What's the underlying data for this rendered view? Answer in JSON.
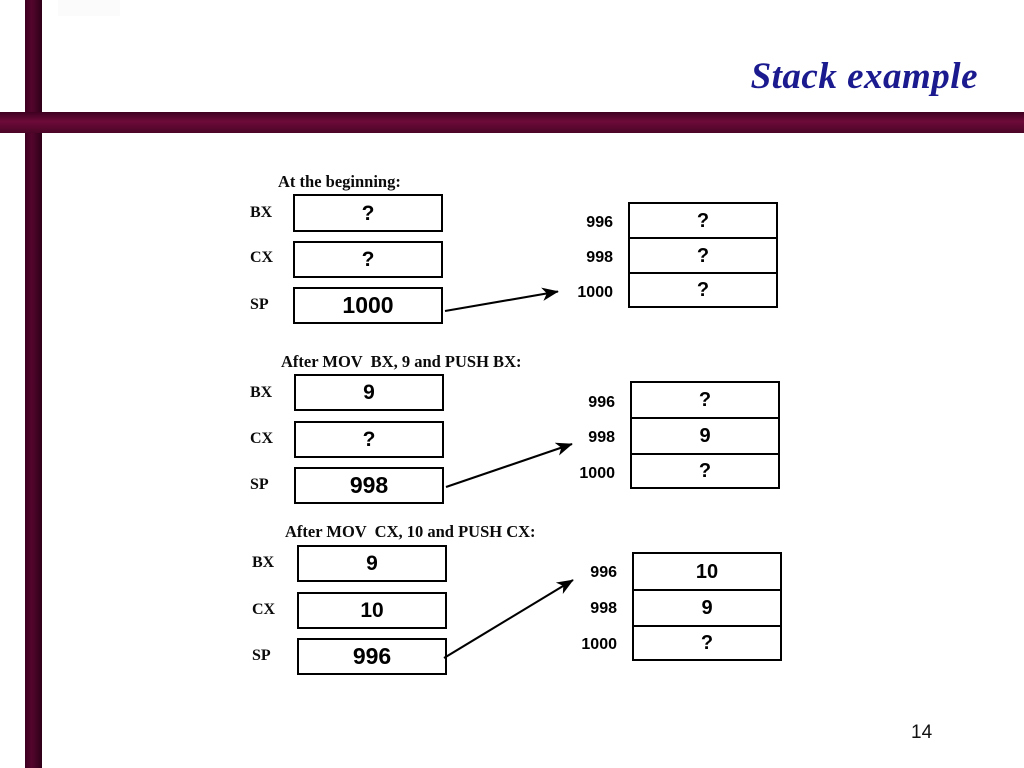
{
  "slide": {
    "title": "Stack example",
    "title_color": "#1b1b8f",
    "accent_color": "#54052c",
    "page_number": "14"
  },
  "blocks": [
    {
      "heading": "At the beginning:",
      "registers": [
        {
          "label": "BX",
          "value": "?"
        },
        {
          "label": "CX",
          "value": "?"
        },
        {
          "label": "SP",
          "value": "1000"
        }
      ],
      "memory": {
        "addresses": [
          "996",
          "998",
          "1000"
        ],
        "values": [
          "?",
          "?",
          "?"
        ]
      },
      "arrow": {
        "points_to_address": "1000"
      }
    },
    {
      "heading": "After MOV  BX, 9 and PUSH BX:",
      "registers": [
        {
          "label": "BX",
          "value": "9"
        },
        {
          "label": "CX",
          "value": "?"
        },
        {
          "label": "SP",
          "value": "998"
        }
      ],
      "memory": {
        "addresses": [
          "996",
          "998",
          "1000"
        ],
        "values": [
          "?",
          "9",
          "?"
        ]
      },
      "arrow": {
        "points_to_address": "998"
      }
    },
    {
      "heading": "After MOV  CX, 10 and PUSH CX:",
      "registers": [
        {
          "label": "BX",
          "value": "9"
        },
        {
          "label": "CX",
          "value": "10"
        },
        {
          "label": "SP",
          "value": "996"
        }
      ],
      "memory": {
        "addresses": [
          "996",
          "998",
          "1000"
        ],
        "values": [
          "10",
          "9",
          "?"
        ]
      },
      "arrow": {
        "points_to_address": "996"
      }
    }
  ]
}
